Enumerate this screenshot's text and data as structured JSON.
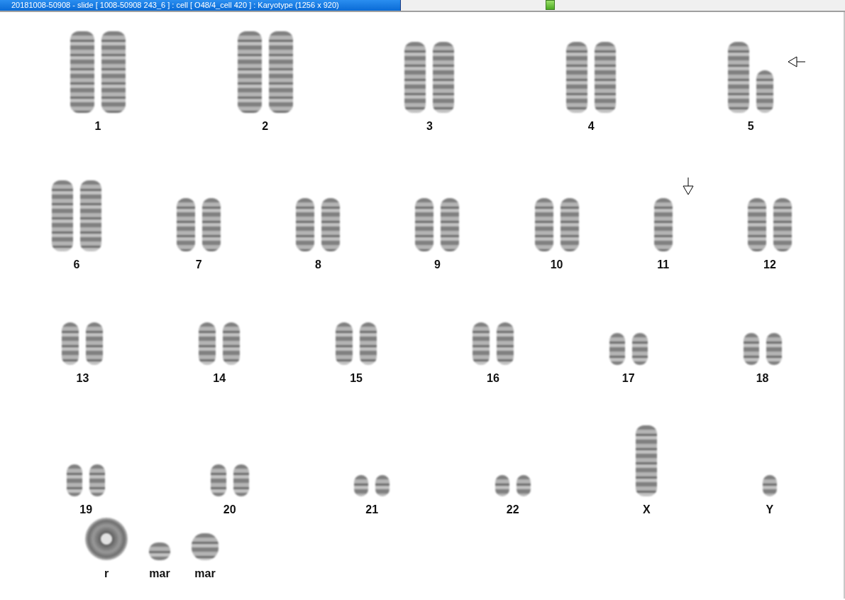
{
  "window": {
    "title": "20181008-50908 - slide [ 1008-50908 243_6 ] : cell [ O48/4_cell 420 ] : Karyotype  (1256 x 920)"
  },
  "karyotype": {
    "rows": [
      {
        "groups": [
          {
            "label": "1",
            "shapes": [
              {
                "kind": "xl"
              },
              {
                "kind": "xl"
              }
            ]
          },
          {
            "label": "2",
            "shapes": [
              {
                "kind": "xl"
              },
              {
                "kind": "xl"
              }
            ]
          },
          {
            "label": "3",
            "shapes": [
              {
                "kind": "l"
              },
              {
                "kind": "l"
              }
            ]
          },
          {
            "label": "4",
            "shapes": [
              {
                "kind": "l"
              },
              {
                "kind": "l"
              }
            ]
          },
          {
            "label": "5",
            "shapes": [
              {
                "kind": "l"
              },
              {
                "kind": "s"
              }
            ],
            "marker": {
              "kind": "left"
            }
          }
        ]
      },
      {
        "groups": [
          {
            "label": "6",
            "shapes": [
              {
                "kind": "l"
              },
              {
                "kind": "l"
              }
            ]
          },
          {
            "label": "7",
            "shapes": [
              {
                "kind": "m"
              },
              {
                "kind": "m"
              }
            ]
          },
          {
            "label": "8",
            "shapes": [
              {
                "kind": "m"
              },
              {
                "kind": "m"
              }
            ]
          },
          {
            "label": "9",
            "shapes": [
              {
                "kind": "m"
              },
              {
                "kind": "m"
              }
            ]
          },
          {
            "label": "10",
            "shapes": [
              {
                "kind": "m"
              },
              {
                "kind": "m"
              }
            ]
          },
          {
            "label": "11",
            "shapes": [
              {
                "kind": "m"
              }
            ],
            "marker": {
              "kind": "down"
            }
          },
          {
            "label": "12",
            "shapes": [
              {
                "kind": "m"
              },
              {
                "kind": "m"
              }
            ]
          }
        ]
      },
      {
        "groups": [
          {
            "label": "13",
            "shapes": [
              {
                "kind": "s"
              },
              {
                "kind": "s"
              }
            ]
          },
          {
            "label": "14",
            "shapes": [
              {
                "kind": "s"
              },
              {
                "kind": "s"
              }
            ]
          },
          {
            "label": "15",
            "shapes": [
              {
                "kind": "s"
              },
              {
                "kind": "s"
              }
            ]
          },
          {
            "label": "16",
            "shapes": [
              {
                "kind": "s"
              },
              {
                "kind": "s"
              }
            ]
          },
          {
            "label": "17",
            "shapes": [
              {
                "kind": "xs"
              },
              {
                "kind": "xs"
              }
            ]
          },
          {
            "label": "18",
            "shapes": [
              {
                "kind": "xs"
              },
              {
                "kind": "xs"
              }
            ]
          }
        ]
      },
      {
        "groups": [
          {
            "label": "19",
            "shapes": [
              {
                "kind": "xs"
              },
              {
                "kind": "xs"
              }
            ]
          },
          {
            "label": "20",
            "shapes": [
              {
                "kind": "xs"
              },
              {
                "kind": "xs"
              }
            ]
          },
          {
            "label": "21",
            "shapes": [
              {
                "kind": "xxs"
              },
              {
                "kind": "xxs"
              }
            ]
          },
          {
            "label": "22",
            "shapes": [
              {
                "kind": "xxs"
              },
              {
                "kind": "xxs"
              }
            ]
          },
          {
            "label": "X",
            "shapes": [
              {
                "kind": "l"
              }
            ]
          },
          {
            "label": "Y",
            "shapes": [
              {
                "kind": "xxs"
              }
            ]
          }
        ]
      },
      {
        "groups": [
          {
            "label": "r",
            "shapes": [
              {
                "kind": "ring"
              }
            ]
          },
          {
            "label": "mar",
            "shapes": [
              {
                "kind": "dot"
              }
            ]
          },
          {
            "label": "mar",
            "shapes": [
              {
                "kind": "blob"
              }
            ]
          }
        ]
      }
    ]
  }
}
